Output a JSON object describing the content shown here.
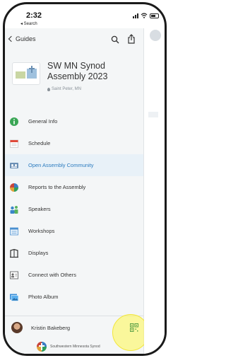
{
  "status_bar": {
    "time": "2:32",
    "back_hint": "◂ Search"
  },
  "nav": {
    "back_label": "Guides",
    "icons": [
      "search-icon",
      "share-icon"
    ]
  },
  "event": {
    "title_line1": "SW MN Synod",
    "title_line2": "Assembly 2023",
    "location": "Saint Peter, MN"
  },
  "menu": {
    "items": [
      {
        "label": "General Info",
        "icon": "info-icon",
        "active": false
      },
      {
        "label": "Schedule",
        "icon": "calendar-icon",
        "active": false
      },
      {
        "label": "Open Assembly Community",
        "icon": "community-icon",
        "active": true
      },
      {
        "label": "Reports to the Assembly",
        "icon": "reports-icon",
        "active": false
      },
      {
        "label": "Speakers",
        "icon": "speakers-icon",
        "active": false
      },
      {
        "label": "Workshops",
        "icon": "workshops-icon",
        "active": false
      },
      {
        "label": "Displays",
        "icon": "displays-icon",
        "active": false
      },
      {
        "label": "Connect with Others",
        "icon": "connect-icon",
        "active": false
      },
      {
        "label": "Photo Album",
        "icon": "photo-icon",
        "active": false
      }
    ]
  },
  "user": {
    "name": "Kristin Bakeberg"
  },
  "org": {
    "name": "Southwestern Minnesota Synod"
  },
  "colors": {
    "accent": "#2b7bbf",
    "active_bg": "#e8f1f8",
    "highlight": "#fff850"
  }
}
